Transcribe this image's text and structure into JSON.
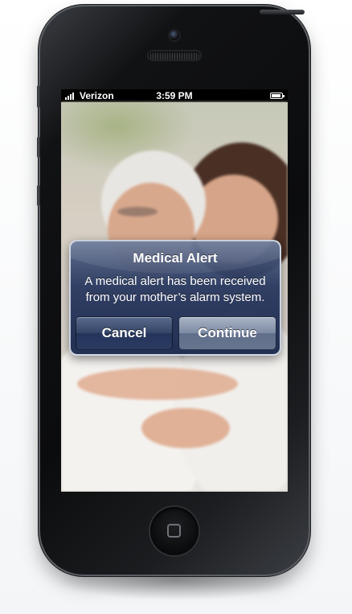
{
  "status_bar": {
    "carrier": "Verizon",
    "time": "3:59 PM",
    "signal_bars": 4,
    "battery_icon": "battery-full-icon"
  },
  "alert": {
    "title": "Medical Alert",
    "message": "A medical alert has been received from your mother’s alarm system.",
    "buttons": {
      "cancel_label": "Cancel",
      "continue_label": "Continue"
    }
  },
  "colors": {
    "alert_background": "#24345a",
    "alert_border": "#e6ecf6",
    "device_body": "#0b0c0d",
    "status_bar": "#000000"
  },
  "icons": {
    "home": "home-button-icon",
    "camera": "front-camera-icon",
    "speaker": "earpiece-speaker-icon"
  }
}
